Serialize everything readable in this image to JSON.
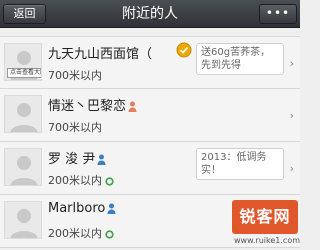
{
  "header": {
    "back_label": "返回",
    "title": "附近的人",
    "more_label": "•••"
  },
  "people": [
    {
      "name": "九天九山西面馆（",
      "distance": "700米以内",
      "avatar_hint": "点击查看大图",
      "gender": "",
      "status_bubble": "送60g苦荞茶，先到先得",
      "verified": true
    },
    {
      "name": "情迷丶巴黎恋",
      "distance": "700米以内",
      "avatar_hint": "",
      "gender": "female",
      "status_bubble": "",
      "verified": false
    },
    {
      "name": "罗 浚 尹",
      "distance": "200米以内",
      "avatar_hint": "",
      "gender": "male",
      "status_bubble": "2013：低调务实！",
      "verified": false
    },
    {
      "name": "Marlboro",
      "distance": "200米以内",
      "avatar_hint": "",
      "gender": "male",
      "status_bubble": "",
      "verified": false
    }
  ],
  "watermark": {
    "logo_text": "锐客网",
    "url": "www.ruike1.com"
  },
  "colors": {
    "titlebar": "#35393d",
    "female": "#e08060",
    "male": "#3a7fc0",
    "verified": "#f0a800"
  }
}
